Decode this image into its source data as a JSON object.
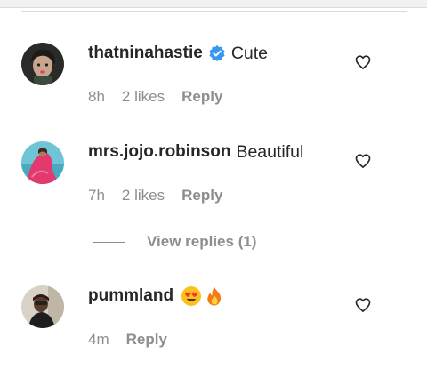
{
  "comments": [
    {
      "username": "thatninahastie",
      "verified": true,
      "text": "Cute",
      "time": "8h",
      "likes": "2 likes",
      "reply_label": "Reply"
    },
    {
      "username": "mrs.jojo.robinson",
      "verified": false,
      "text": "Beautiful",
      "time": "7h",
      "likes": "2 likes",
      "reply_label": "Reply",
      "view_replies": "View replies (1)"
    },
    {
      "username": "pummland",
      "verified": false,
      "emojis": [
        "heart-eyes-emoji",
        "fire-emoji"
      ],
      "time": "4m",
      "reply_label": "Reply"
    }
  ],
  "colors": {
    "primary_text": "#262626",
    "secondary_text": "#8e8e8e",
    "verified_badge": "#3897f0"
  }
}
